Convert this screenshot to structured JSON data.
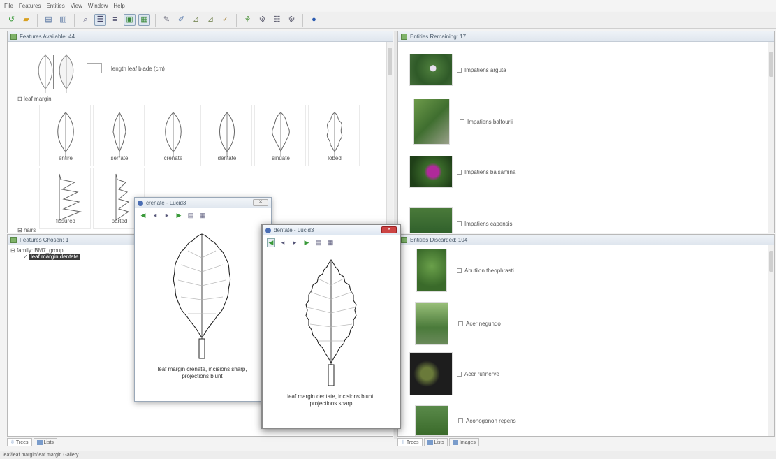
{
  "menu": {
    "items": [
      "File",
      "Features",
      "Entities",
      "View",
      "Window",
      "Help"
    ]
  },
  "toolbar": {
    "icons": [
      "restart-icon",
      "open-folder-icon",
      "key-icon",
      "key-edit-icon",
      "find-icon",
      "tree-view-icon",
      "list-view-icon",
      "images-icon",
      "gallery-icon",
      "tag-icon",
      "pen-icon",
      "ruler-icon",
      "measure-icon",
      "select-icon",
      "score-icon",
      "settings-icon",
      "filter-icon",
      "options-icon",
      "help-icon"
    ]
  },
  "features_available": {
    "title": "Features Available: 44",
    "length_label": "length leaf blade (cm)",
    "leaf_margin_label": "leaf margin",
    "margins": [
      "entire",
      "serrate",
      "crenate",
      "dentate",
      "sinuate",
      "lobed",
      "fissured",
      "parted"
    ],
    "next_group_label": "hairs"
  },
  "features_chosen": {
    "title": "Features Chosen: 1",
    "root": "family: BM7_group",
    "selected": "leaf margin dentate"
  },
  "left_tabs": [
    "Trees",
    "Lists"
  ],
  "entities_remaining": {
    "title": "Entities Remaining: 17",
    "items": [
      "Impatiens arguta",
      "Impatiens balfourii",
      "Impatiens balsamina",
      "Impatiens capensis"
    ]
  },
  "entities_discarded": {
    "title": "Entities Discarded: 104",
    "items": [
      "Abutilon theophrasti",
      "Acer negundo",
      "Acer rufinerve",
      "Aconogonon repens"
    ]
  },
  "right_tabs": [
    "Trees",
    "Lists",
    "Images"
  ],
  "window_crenate": {
    "title": "crenate - Lucid3",
    "caption_line1": "leaf margin crenate, incisions sharp,",
    "caption_line2": "projections blunt"
  },
  "window_dentate": {
    "title": "dentate - Lucid3",
    "caption_line1": "leaf margin dentate, incisions blunt,",
    "caption_line2": "projections sharp"
  },
  "status": "leaf/leaf margin/leaf margin Gallery",
  "colors": {
    "title_bar": "#e4eaf1",
    "panel_icon": "#7fb36a",
    "selection": "#3a3a3a",
    "close_active": "#cc4444"
  }
}
